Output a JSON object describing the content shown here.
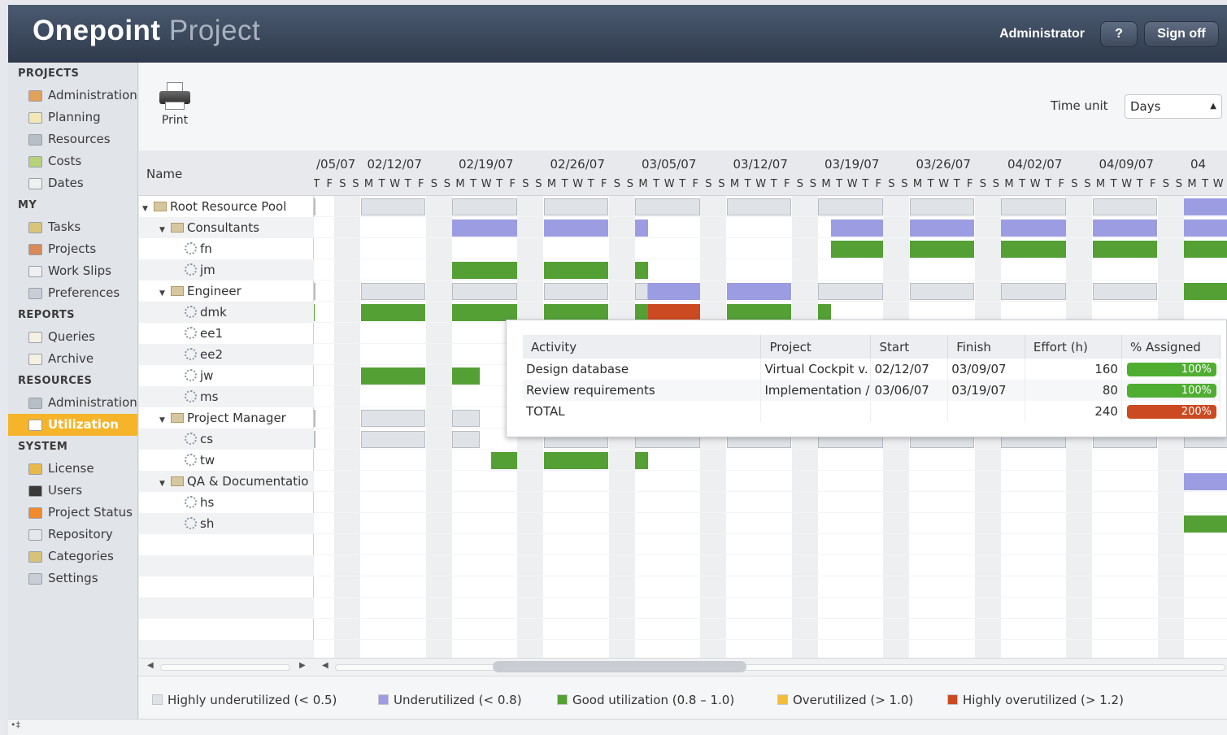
{
  "app": {
    "logo_bold": "Onepoint",
    "logo_light": "Project",
    "user": "Administrator",
    "help_label": "?",
    "signoff_label": "Sign off"
  },
  "sidebar": {
    "sections": [
      {
        "title": "PROJECTS",
        "items": [
          {
            "label": "Administration",
            "icon": "folder-admin-icon",
            "color": "#e0a25a"
          },
          {
            "label": "Planning",
            "icon": "planning-icon",
            "color": "#f2e7b5"
          },
          {
            "label": "Resources",
            "icon": "resources-gear-icon",
            "color": "#b8bec8"
          },
          {
            "label": "Costs",
            "icon": "costs-icon",
            "color": "#b7d27b"
          },
          {
            "label": "Dates",
            "icon": "dates-icon",
            "color": "#f0f0f0"
          }
        ]
      },
      {
        "title": "MY",
        "items": [
          {
            "label": "Tasks",
            "icon": "tasks-icon",
            "color": "#d9c47a"
          },
          {
            "label": "Projects",
            "icon": "my-projects-icon",
            "color": "#d88a5a"
          },
          {
            "label": "Work Slips",
            "icon": "work-slips-icon",
            "color": "#eef0f2"
          },
          {
            "label": "Preferences",
            "icon": "preferences-icon",
            "color": "#c9ced6"
          }
        ]
      },
      {
        "title": "REPORTS",
        "items": [
          {
            "label": "Queries",
            "icon": "queries-icon",
            "color": "#f4f0e2"
          },
          {
            "label": "Archive",
            "icon": "archive-icon",
            "color": "#f4f0e2"
          }
        ]
      },
      {
        "title": "RESOURCES",
        "items": [
          {
            "label": "Administration",
            "icon": "resource-admin-icon",
            "color": "#b8bec8"
          },
          {
            "label": "Utilization",
            "icon": "utilization-icon",
            "color": "#ffffff",
            "active": true
          }
        ]
      },
      {
        "title": "SYSTEM",
        "items": [
          {
            "label": "License",
            "icon": "key-icon",
            "color": "#e9b84a"
          },
          {
            "label": "Users",
            "icon": "user-icon",
            "color": "#3a3a3a"
          },
          {
            "label": "Project Status",
            "icon": "status-icon",
            "color": "#f08a2a"
          },
          {
            "label": "Repository",
            "icon": "repository-icon",
            "color": "#e4e7eb"
          },
          {
            "label": "Categories",
            "icon": "categories-icon",
            "color": "#d8c27a"
          },
          {
            "label": "Settings",
            "icon": "settings-icon",
            "color": "#c9ced6"
          }
        ]
      }
    ]
  },
  "toolbar": {
    "print_label": "Print",
    "time_unit_label": "Time unit",
    "time_unit_value": "Days"
  },
  "grid": {
    "name_header": "Name",
    "weeks": [
      "/05/07",
      "02/12/07",
      "02/19/07",
      "02/26/07",
      "03/05/07",
      "03/12/07",
      "03/19/07",
      "03/26/07",
      "04/02/07",
      "04/09/07",
      "04"
    ],
    "day_letters": [
      "M",
      "T",
      "W",
      "T",
      "F",
      "S",
      "S"
    ],
    "rows": [
      {
        "label": "Root Resource Pool",
        "level": 0,
        "type": "folder",
        "expanded": true
      },
      {
        "label": "Consultants",
        "level": 1,
        "type": "folder",
        "expanded": true
      },
      {
        "label": "fn",
        "level": 2,
        "type": "resource"
      },
      {
        "label": "jm",
        "level": 2,
        "type": "resource"
      },
      {
        "label": "Engineer",
        "level": 1,
        "type": "folder",
        "expanded": true
      },
      {
        "label": "dmk",
        "level": 2,
        "type": "resource"
      },
      {
        "label": "ee1",
        "level": 2,
        "type": "resource"
      },
      {
        "label": "ee2",
        "level": 2,
        "type": "resource"
      },
      {
        "label": "jw",
        "level": 2,
        "type": "resource"
      },
      {
        "label": "ms",
        "level": 2,
        "type": "resource"
      },
      {
        "label": "Project Manager",
        "level": 1,
        "type": "folder",
        "expanded": true
      },
      {
        "label": "cs",
        "level": 2,
        "type": "resource"
      },
      {
        "label": "tw",
        "level": 2,
        "type": "resource"
      },
      {
        "label": "QA & Documentatio",
        "level": 1,
        "type": "folder",
        "expanded": true
      },
      {
        "label": "hs",
        "level": 2,
        "type": "resource"
      },
      {
        "label": "sh",
        "level": 2,
        "type": "resource"
      }
    ],
    "bars": [
      {
        "row": 0,
        "spans": [
          [
            -0.05,
            0.5,
            "hu"
          ],
          [
            1,
            1.71,
            "hu"
          ],
          [
            2,
            2.71,
            "hu"
          ],
          [
            3,
            3.71,
            "hu"
          ],
          [
            4,
            4.71,
            "hu"
          ],
          [
            5,
            5.71,
            "hu"
          ],
          [
            6,
            6.71,
            "hu"
          ],
          [
            7,
            7.71,
            "hu"
          ],
          [
            8,
            8.71,
            "hu"
          ],
          [
            9,
            9.71,
            "hu"
          ],
          [
            10,
            10.5,
            "u"
          ]
        ]
      },
      {
        "row": 1,
        "spans": [
          [
            2,
            2.71,
            "u"
          ],
          [
            3,
            3.71,
            "u"
          ],
          [
            4,
            4.14,
            "u"
          ],
          [
            6.14,
            6.71,
            "u"
          ],
          [
            7,
            7.71,
            "u"
          ],
          [
            8,
            8.71,
            "u"
          ],
          [
            9,
            9.71,
            "u"
          ],
          [
            10,
            10.5,
            "u"
          ]
        ]
      },
      {
        "row": 2,
        "spans": [
          [
            6.14,
            6.71,
            "g"
          ],
          [
            7,
            7.71,
            "g"
          ],
          [
            8,
            8.71,
            "g"
          ],
          [
            9,
            9.71,
            "g"
          ],
          [
            10,
            10.5,
            "g"
          ]
        ]
      },
      {
        "row": 3,
        "spans": [
          [
            2,
            2.71,
            "g"
          ],
          [
            3,
            3.71,
            "g"
          ],
          [
            4,
            4.14,
            "g"
          ]
        ]
      },
      {
        "row": 4,
        "spans": [
          [
            -0.05,
            0.5,
            "hu"
          ],
          [
            1,
            1.71,
            "hu"
          ],
          [
            2,
            2.71,
            "hu"
          ],
          [
            3,
            3.71,
            "hu"
          ],
          [
            4,
            4.14,
            "hu"
          ],
          [
            4.14,
            4.71,
            "u"
          ],
          [
            5,
            5.71,
            "u"
          ],
          [
            6,
            6.71,
            "hu"
          ],
          [
            7,
            7.71,
            "hu"
          ],
          [
            8,
            8.71,
            "hu"
          ],
          [
            9,
            9.71,
            "hu"
          ],
          [
            10,
            10.5,
            "g"
          ]
        ]
      },
      {
        "row": 5,
        "spans": [
          [
            -0.05,
            0.5,
            "g"
          ],
          [
            1,
            1.71,
            "g"
          ],
          [
            2,
            2.71,
            "g"
          ],
          [
            3,
            3.71,
            "g"
          ],
          [
            4,
            4.14,
            "g"
          ],
          [
            4.14,
            4.71,
            "ho"
          ],
          [
            5,
            5.71,
            "g"
          ],
          [
            6,
            6.14,
            "g"
          ]
        ]
      },
      {
        "row": 8,
        "spans": [
          [
            1,
            1.71,
            "g"
          ],
          [
            2,
            2.3,
            "g"
          ]
        ]
      },
      {
        "row": 10,
        "spans": [
          [
            -0.05,
            0.5,
            "hu"
          ],
          [
            1,
            1.71,
            "hu"
          ],
          [
            2,
            2.3,
            "hu"
          ]
        ]
      },
      {
        "row": 11,
        "spans": [
          [
            -0.05,
            0.5,
            "hu"
          ],
          [
            1,
            1.71,
            "hu"
          ],
          [
            2,
            2.3,
            "hu"
          ],
          [
            3,
            3.71,
            "hu"
          ],
          [
            4,
            4.71,
            "hu"
          ],
          [
            5,
            5.71,
            "hu"
          ],
          [
            6,
            6.71,
            "hu"
          ],
          [
            7,
            7.71,
            "hu"
          ],
          [
            8,
            8.71,
            "hu"
          ],
          [
            9,
            9.71,
            "hu"
          ],
          [
            10,
            10.5,
            "hu"
          ]
        ]
      },
      {
        "row": 12,
        "spans": [
          [
            2.43,
            2.71,
            "g"
          ],
          [
            3,
            3.71,
            "g"
          ],
          [
            4,
            4.14,
            "g"
          ]
        ]
      },
      {
        "row": 13,
        "spans": [
          [
            10,
            10.5,
            "u"
          ]
        ]
      },
      {
        "row": 15,
        "spans": [
          [
            10,
            10.5,
            "g"
          ]
        ]
      }
    ]
  },
  "colors": {
    "hu": "#dfe2e7",
    "u": "#9c9ce3",
    "g": "#54a035",
    "o": "#f2be3a",
    "ho": "#cc4a21"
  },
  "popup": {
    "headers": [
      "Activity",
      "Project",
      "Start",
      "Finish",
      "Effort (h)",
      "% Assigned"
    ],
    "rows": [
      {
        "activity": "Design database",
        "project": "Virtual Cockpit v.",
        "start": "02/12/07",
        "finish": "03/09/07",
        "effort": "160",
        "assigned": "100%",
        "assigned_value": 100,
        "color": "#4fae32"
      },
      {
        "activity": "Review requirements",
        "project": "Implementation /",
        "start": "03/06/07",
        "finish": "03/19/07",
        "effort": "80",
        "assigned": "100%",
        "assigned_value": 100,
        "color": "#4fae32"
      },
      {
        "activity": "TOTAL",
        "project": "",
        "start": "",
        "finish": "",
        "effort": "240",
        "assigned": "200%",
        "assigned_value": 200,
        "color": "#cc4a21"
      }
    ]
  },
  "legend": [
    {
      "label": "Highly underutilized (< 0.5)",
      "color": "#dfe2e7"
    },
    {
      "label": "Underutilized (< 0.8)",
      "color": "#9c9ce3"
    },
    {
      "label": "Good utilization (0.8 – 1.0)",
      "color": "#54a035"
    },
    {
      "label": "Overutilized (> 1.0)",
      "color": "#f2be3a"
    },
    {
      "label": "Highly overutilized (> 1.2)",
      "color": "#cc4a21"
    }
  ],
  "statusbar": {
    "text": "•‡"
  }
}
